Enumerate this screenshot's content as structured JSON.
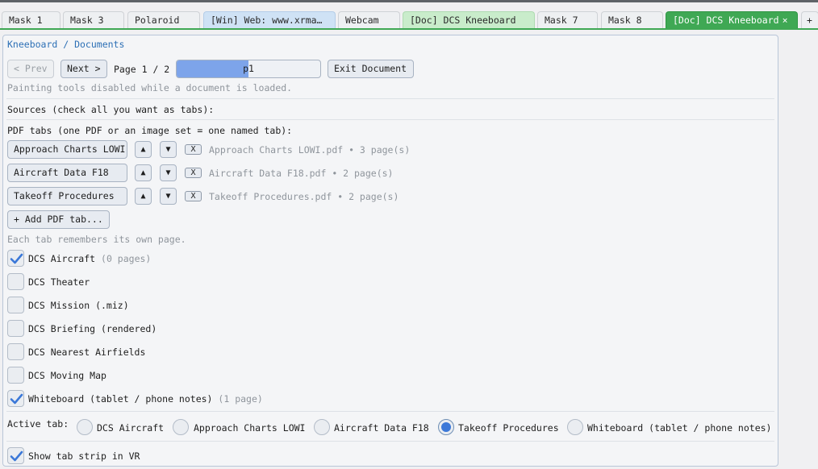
{
  "tabs": [
    {
      "label": "Mask 1",
      "kind": "normal"
    },
    {
      "label": "Mask 3",
      "kind": "normal"
    },
    {
      "label": "Polaroid",
      "kind": "normal"
    },
    {
      "label": "[Win] Web: www.xrma…",
      "kind": "web"
    },
    {
      "label": "Webcam",
      "kind": "normal"
    },
    {
      "label": "[Doc] DCS Kneeboard",
      "kind": "doc"
    },
    {
      "label": "Mask 7",
      "kind": "normal"
    },
    {
      "label": "Mask 8",
      "kind": "normal"
    },
    {
      "label": "[Doc] DCS Kneeboard",
      "kind": "active",
      "close": "×"
    },
    {
      "label": "+",
      "kind": "normal"
    }
  ],
  "colors": {
    "active_tab": "#3fa854",
    "accent": "#3b78d8",
    "breadcrumb": "#2c6fb5"
  },
  "breadcrumb": "Kneeboard / Documents",
  "nav": {
    "prev_label": "< Prev",
    "next_label": "Next >",
    "page_label": "Page 1 / 2",
    "page_value": "p1",
    "page_progress": 0.5,
    "exit_label": "Exit Document"
  },
  "painting_note": "Painting tools disabled while a document is loaded.",
  "sources_header": "Sources (check all you want as tabs):",
  "pdf_header": "PDF tabs (one PDF or an image set = one named tab):",
  "pdf_tabs": [
    {
      "name": "Approach Charts LOWI",
      "info": "Approach Charts LOWI.pdf • 3 page(s)"
    },
    {
      "name": "Aircraft Data F18",
      "info": "Aircraft Data F18.pdf • 2 page(s)"
    },
    {
      "name": "Takeoff Procedures",
      "info": "Takeoff Procedures.pdf • 2 page(s)"
    }
  ],
  "pdf_controls": {
    "up": "▲",
    "down": "▼",
    "remove": "X"
  },
  "add_pdf_label": "+ Add PDF tab...",
  "tab_memory_note": "Each tab remembers its own page.",
  "sources": [
    {
      "label": "DCS Aircraft",
      "note": "(0 pages)",
      "checked": true
    },
    {
      "label": "DCS Theater",
      "note": "",
      "checked": false
    },
    {
      "label": "DCS Mission (.miz)",
      "note": "",
      "checked": false
    },
    {
      "label": "DCS Briefing (rendered)",
      "note": "",
      "checked": false
    },
    {
      "label": "DCS Nearest Airfields",
      "note": "",
      "checked": false
    },
    {
      "label": "DCS Moving Map",
      "note": "",
      "checked": false
    },
    {
      "label": "Whiteboard (tablet / phone notes)",
      "note": "(1 page)",
      "checked": true
    }
  ],
  "active_tab": {
    "label": "Active tab:",
    "options": [
      {
        "label": "DCS Aircraft",
        "selected": false
      },
      {
        "label": "Approach Charts LOWI",
        "selected": false
      },
      {
        "label": "Aircraft Data F18",
        "selected": false
      },
      {
        "label": "Takeoff Procedures",
        "selected": true
      },
      {
        "label": "Whiteboard (tablet / phone notes)",
        "selected": false
      }
    ]
  },
  "show_tab_strip": {
    "label": "Show tab strip in VR",
    "checked": true
  }
}
